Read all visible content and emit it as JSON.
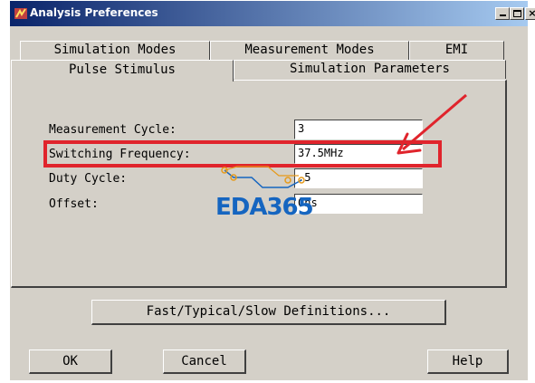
{
  "window": {
    "title": "Analysis Preferences",
    "close_symbol": "×"
  },
  "tabs": {
    "row1": [
      "Simulation Modes",
      "Measurement Modes",
      "EMI"
    ],
    "row2": [
      "Pulse Stimulus",
      "Simulation Parameters"
    ],
    "active": "Pulse Stimulus"
  },
  "fields": [
    {
      "label": "Measurement Cycle:",
      "value": "3"
    },
    {
      "label": "Switching Frequency:",
      "value": "37.5MHz"
    },
    {
      "label": "Duty Cycle:",
      "value": ".5"
    },
    {
      "label": "Offset:",
      "value": "0ns"
    }
  ],
  "buttons": {
    "definitions": "Fast/Typical/Slow Definitions...",
    "ok": "OK",
    "cancel": "Cancel",
    "help": "Help"
  },
  "annotations": {
    "highlight_color": "#e0242c",
    "watermark": "EDA365",
    "watermark_color": "#1565c0"
  },
  "icons": [
    "app-icon",
    "minimize-icon",
    "maximize-icon",
    "close-icon",
    "arrow-annotation-icon",
    "circuit-trace-icon"
  ]
}
